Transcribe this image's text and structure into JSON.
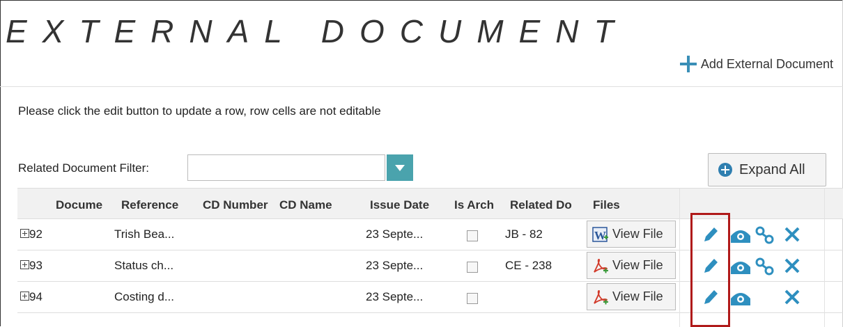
{
  "page": {
    "title": "EXTERNAL DOCUMENT",
    "add_label": "Add External Document",
    "hint": "Please click the edit button to update a row, row cells are not editable",
    "filter_label": "Related Document Filter:",
    "filter_value": "",
    "expand_label": "Expand All"
  },
  "columns": [
    "Docume",
    "Reference",
    "CD Number",
    "CD Name",
    "Issue Date",
    "Is Arch",
    "Related Do",
    "Files"
  ],
  "rows": [
    {
      "doc": "92",
      "reference": "Trish Bea...",
      "issue_date": "23 Septe...",
      "related": "JB - 82",
      "file_label": "View File",
      "file_type": "word-doc-icon",
      "link_icon": true
    },
    {
      "doc": "93",
      "reference": "Status ch...",
      "issue_date": "23 Septe...",
      "related": "CE - 238",
      "file_label": "View File",
      "file_type": "pdf-icon",
      "link_icon": true
    },
    {
      "doc": "94",
      "reference": "Costing d...",
      "issue_date": "23 Septe...",
      "related": "",
      "file_label": "View File",
      "file_type": "pdf-icon",
      "link_icon": false
    }
  ],
  "colors": {
    "accent": "#2f7fb0",
    "teal": "#4aa3ad",
    "highlight": "#b01a1a",
    "icon_blue": "#2e8fbf"
  }
}
